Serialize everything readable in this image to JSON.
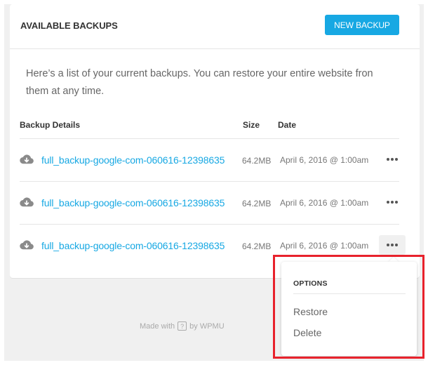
{
  "card": {
    "title": "AVAILABLE BACKUPS",
    "new_backup_label": "NEW BACKUP",
    "intro": "Here’s a list of your current backups. You can restore your entire website fron them at any time."
  },
  "table": {
    "columns": [
      "Backup Details",
      "Size",
      "Date"
    ],
    "rows": [
      {
        "file": "full_backup-google-com-060616-12398635",
        "size": "64.2MB",
        "date": "April 6, 2016 @ 1:00am"
      },
      {
        "file": "full_backup-google-com-060616-12398635",
        "size": "64.2MB",
        "date": "April 6, 2016 @ 1:00am"
      },
      {
        "file": "full_backup-google-com-060616-12398635",
        "size": "64.2MB",
        "date": "April 6, 2016 @ 1:00am"
      }
    ]
  },
  "options_menu": {
    "title": "OPTIONS",
    "items": [
      "Restore",
      "Delete"
    ]
  },
  "footer": {
    "made_with": "Made with",
    "help_glyph": "?",
    "by": "by WPMU"
  },
  "icons": {
    "row_icon": "cloud-download-icon",
    "menu_icon": "more-dots-icon"
  },
  "colors": {
    "accent": "#17a8e3",
    "highlight": "#e8222c"
  }
}
